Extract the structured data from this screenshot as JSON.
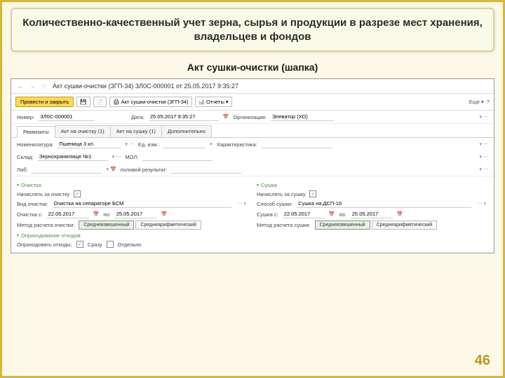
{
  "slide": {
    "title": "Количественно-качественный учет зерна, сырья и продукции в разрезе мест хранения, владельцев и фондов",
    "subtitle": "Акт сушки-очистки (шапка)",
    "page_num": "46"
  },
  "window": {
    "title": "Акт сушки-очистки (ЗГП-34) ЗЛ0С-000001 от 25.05.2017 9:35:27",
    "nav_back": "←",
    "nav_fwd": "→",
    "star": "☆"
  },
  "toolbar": {
    "save_close": "Провести и закрыть",
    "save_icon": "💾",
    "post_icon": "📄",
    "print1": "Акт сушки-очистки (ЗГП-34)",
    "reports": "Отчеты",
    "more": "Еще",
    "help": "?"
  },
  "header": {
    "number_lbl": "Номер:",
    "number_val": "ЗЛ0С-000001",
    "date_lbl": "Дата:",
    "date_val": "25.05.2017 9:35:27",
    "org_lbl": "Организация:",
    "org_val": "Элеватор (ХО)"
  },
  "tabs": {
    "t1": "Реквизиты",
    "t2": "Акт на очистку (1)",
    "t3": "Акт на сушку (1)",
    "t4": "Дополнительно"
  },
  "row1": {
    "nomen_lbl": "Номенклатура:",
    "nomen_val": "Пшеница 3 кл.",
    "unit_lbl": "Ед. изм.:",
    "char_lbl": "Характеристика:"
  },
  "row2": {
    "sklad_lbl": "Склад:",
    "sklad_val": "Зернохранилище №1",
    "mol_lbl": "МОЛ:"
  },
  "row3": {
    "lab_lbl": "Лаб:",
    "half_lbl": "половой результат:"
  },
  "clean": {
    "title": "Очистка",
    "pass_lbl": "Начислять за очистку",
    "type_lbl": "Вид очистки:",
    "type_val": "Очистка на сепараторе БСМ",
    "from_lbl": "Очистка с:",
    "from_val": "22.05.2017",
    "to_lbl": "по:",
    "to_val": "25.05.2017",
    "method_lbl": "Метод расчета очистки:",
    "m1": "Средневзвешенный",
    "m2": "Среднеарифметический"
  },
  "dry": {
    "title": "Сушка",
    "pass_lbl": "Начислять за сушку",
    "type_lbl": "Способ сушки:",
    "type_val": "Сушка на ДСП-16",
    "from_lbl": "Сушка с:",
    "from_val": "22.05.2017",
    "to_lbl": "по:",
    "to_val": "25.05.2017",
    "method_lbl": "Метод расчета сушки:",
    "m1": "Средневзвешенный",
    "m2": "Среднеарифметический"
  },
  "waste": {
    "title": "Оприходование отходов",
    "lbl": "Оприходовать отходы:",
    "opt1": "Сразу",
    "opt2": "Отдельно"
  }
}
